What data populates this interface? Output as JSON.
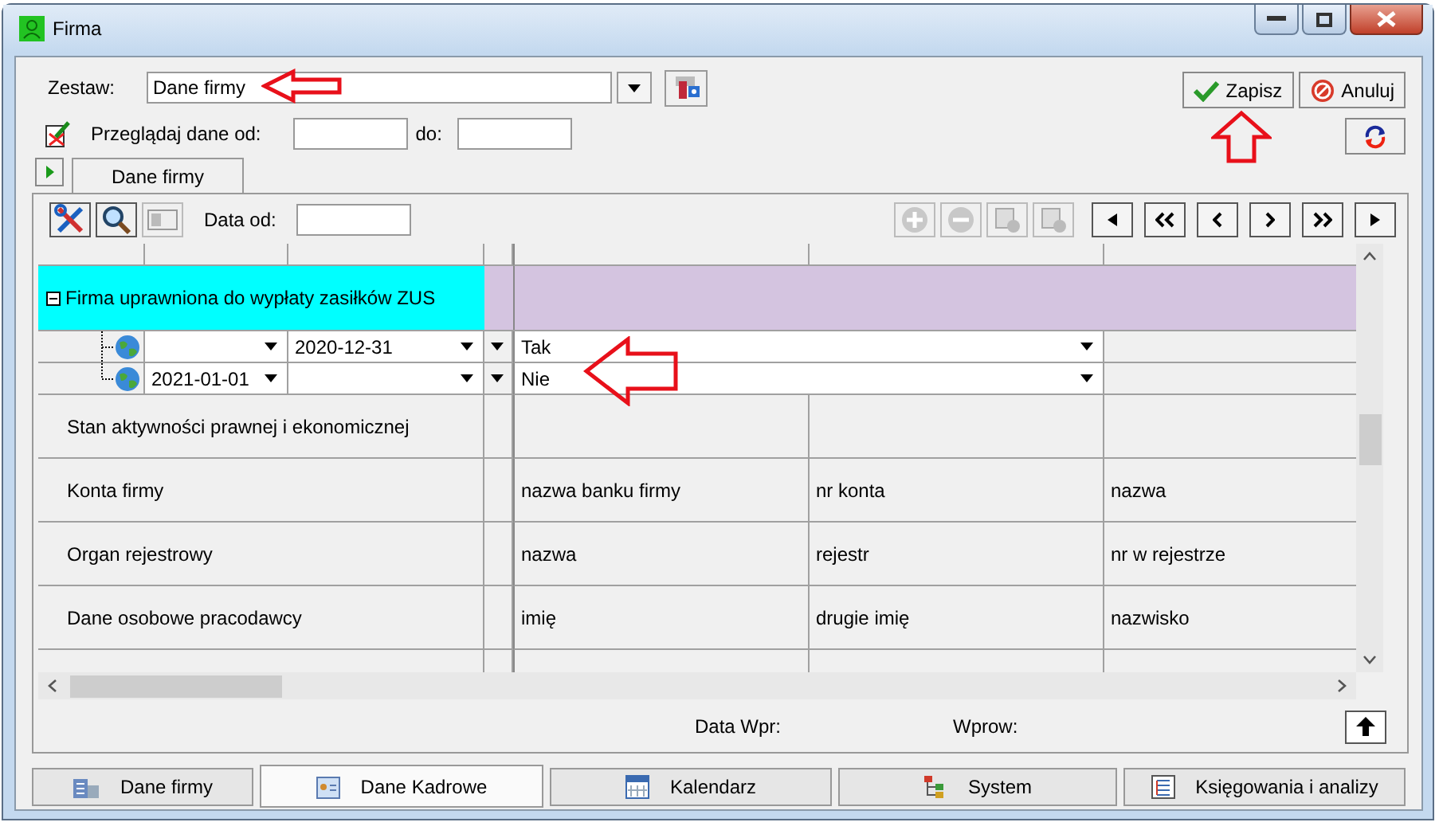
{
  "window": {
    "title": "Firma"
  },
  "header": {
    "set_label": "Zestaw:",
    "set_value": "Dane firmy",
    "range_label": "Przeglądaj dane od:",
    "range_to_label": "do:"
  },
  "buttons": [
    {
      "kind": "save",
      "label": "Zapisz"
    },
    {
      "kind": "cancel",
      "label": "Anuluj"
    }
  ],
  "top_tabs": [
    {
      "label": "Dane firmy",
      "selected": true
    }
  ],
  "grid": {
    "date_label": "Data od:",
    "group": {
      "label": "Firma uprawniona do wypłaty zasiłków ZUS",
      "expanded": true,
      "children": [
        {
          "to": "2020-12-31",
          "value": "Tak"
        },
        {
          "from": "2021-01-01",
          "value": "Nie"
        }
      ]
    },
    "rows": [
      {
        "label": "Stan aktywności prawnej i ekonomicznej",
        "cells": []
      },
      {
        "label": "Konta firmy",
        "cells": [
          "nazwa banku firmy",
          "nr konta",
          "nazwa"
        ]
      },
      {
        "label": "Organ rejestrowy",
        "cells": [
          "nazwa",
          "rejestr",
          "nr w rejestrze"
        ]
      },
      {
        "label": "Dane osobowe pracodawcy",
        "cells": [
          "imię",
          "drugie imię",
          "nazwisko"
        ]
      }
    ]
  },
  "footer": {
    "entry_date_label": "Data Wpr:",
    "entered_by_label": "Wprow:"
  },
  "bottom_tabs": [
    {
      "label": "Dane firmy",
      "kind": "building",
      "selected": false
    },
    {
      "label": "Dane Kadrowe",
      "kind": "card",
      "selected": true
    },
    {
      "label": "Kalendarz",
      "kind": "calendar",
      "selected": false
    },
    {
      "label": "System",
      "kind": "tree",
      "selected": false
    },
    {
      "label": "Księgowania i analizy",
      "kind": "ledger",
      "selected": false
    }
  ]
}
